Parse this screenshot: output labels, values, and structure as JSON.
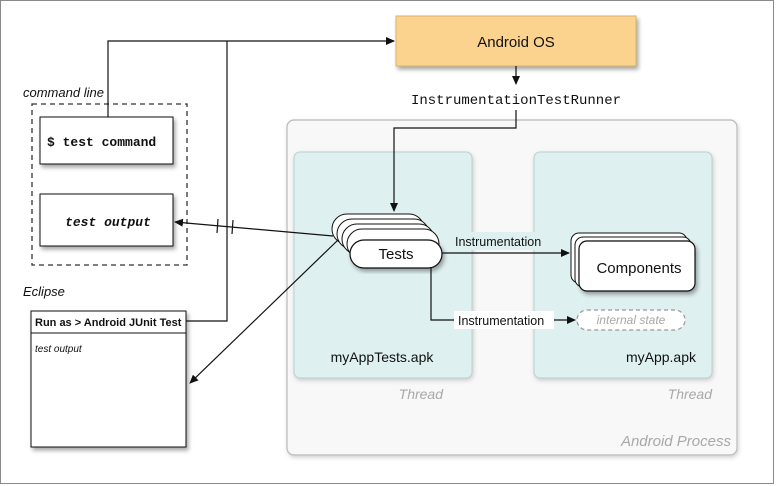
{
  "android_os": {
    "label": "Android OS"
  },
  "runner": {
    "label": "InstrumentationTestRunner"
  },
  "command_line": {
    "caption": "command line",
    "test_command": "$ test command",
    "test_output": "test output"
  },
  "eclipse": {
    "caption": "Eclipse",
    "menu_label": "Run as > Android JUnit Test",
    "output_label": "test output"
  },
  "tests_apk": {
    "label": "myAppTests.apk",
    "thread": "Thread",
    "tests_label": "Tests"
  },
  "app_apk": {
    "label": "myApp.apk",
    "thread": "Thread",
    "components_label": "Components",
    "internal_state": "internal state"
  },
  "process": {
    "label": "Android Process"
  },
  "edges": {
    "instrumentation_1": "Instrumentation",
    "instrumentation_2": "Instrumentation"
  },
  "colors": {
    "android_os_fill": "#fbd38e",
    "apk_fill": "#dff0f1",
    "process_fill": "#f8f8f8"
  }
}
